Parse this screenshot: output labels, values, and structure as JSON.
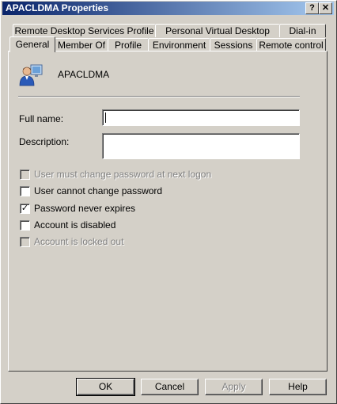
{
  "window": {
    "title": "APACLDMA Properties",
    "help_glyph": "?",
    "close_glyph": "✕"
  },
  "tabs": {
    "row1": [
      {
        "label": "Remote Desktop Services Profile"
      },
      {
        "label": "Personal Virtual Desktop"
      },
      {
        "label": "Dial-in"
      }
    ],
    "row2": [
      {
        "label": "General",
        "active": true
      },
      {
        "label": "Member Of"
      },
      {
        "label": "Profile"
      },
      {
        "label": "Environment"
      },
      {
        "label": "Sessions"
      },
      {
        "label": "Remote control"
      }
    ]
  },
  "general": {
    "username": "APACLDMA",
    "icon": "user-icon",
    "full_name_label": "Full name:",
    "full_name_value": "",
    "description_label": "Description:",
    "description_value": "",
    "options": [
      {
        "label": "User must change password at next logon",
        "checked": false,
        "enabled": false
      },
      {
        "label": "User cannot change password",
        "checked": false,
        "enabled": true
      },
      {
        "label": "Password never expires",
        "checked": true,
        "enabled": true
      },
      {
        "label": "Account is disabled",
        "checked": false,
        "enabled": true
      },
      {
        "label": "Account is locked out",
        "checked": false,
        "enabled": false
      }
    ]
  },
  "buttons": {
    "ok": "OK",
    "cancel": "Cancel",
    "apply": "Apply",
    "help": "Help"
  },
  "check_glyph": "✓"
}
